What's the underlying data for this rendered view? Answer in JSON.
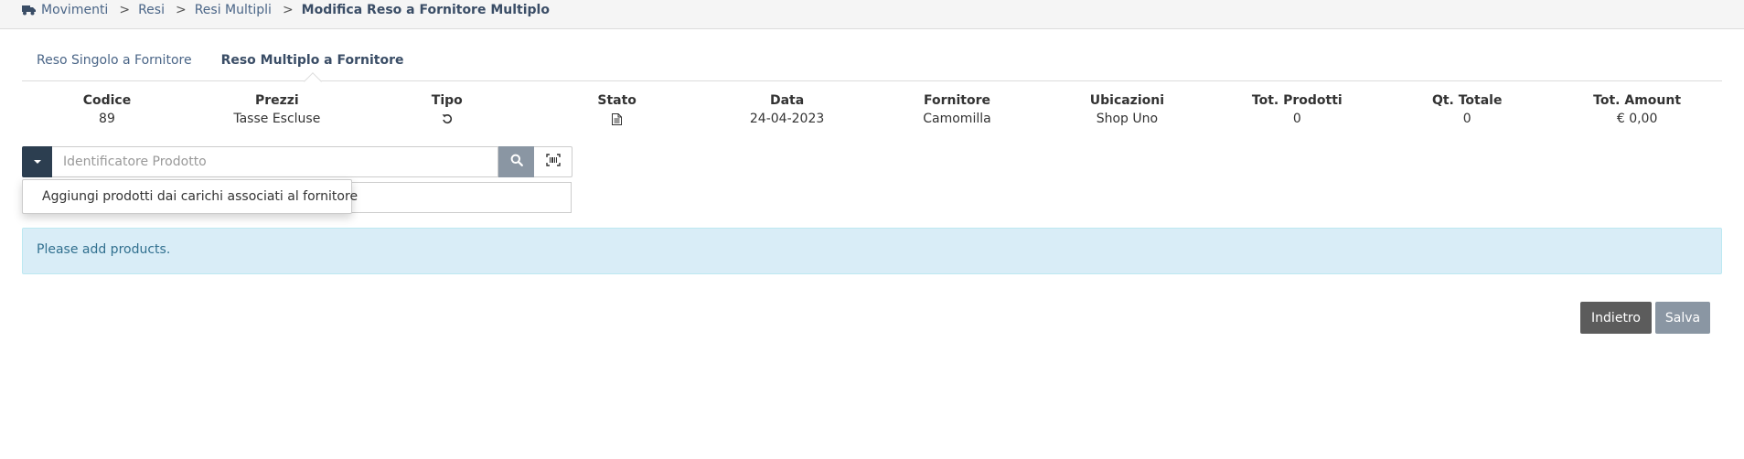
{
  "breadcrumb": {
    "icon": "truck-icon",
    "items": [
      "Movimenti",
      "Resi",
      "Resi Multipli"
    ],
    "separator": ">",
    "current": "Modifica Reso a Fornitore Multiplo"
  },
  "tabs": [
    {
      "label": "Reso Singolo a Fornitore",
      "active": false
    },
    {
      "label": "Reso Multiplo a Fornitore",
      "active": true
    }
  ],
  "summary": {
    "codice": {
      "label": "Codice",
      "value": "89"
    },
    "prezzi": {
      "label": "Prezzi",
      "value": "Tasse Escluse"
    },
    "tipo": {
      "label": "Tipo",
      "icon": "undo-icon"
    },
    "stato": {
      "label": "Stato",
      "icon": "document-icon"
    },
    "data": {
      "label": "Data",
      "value": "24-04-2023"
    },
    "fornitore": {
      "label": "Fornitore",
      "value": "Camomilla"
    },
    "ubicazioni": {
      "label": "Ubicazioni",
      "value": "Shop Uno"
    },
    "tot_prodotti": {
      "label": "Tot. Prodotti",
      "value": "0"
    },
    "qt_totale": {
      "label": "Qt. Totale",
      "value": "0"
    },
    "tot_amount": {
      "label": "Tot. Amount",
      "value": "€ 0,00"
    }
  },
  "search": {
    "placeholder": "Identificatore Prodotto",
    "value": ""
  },
  "dropdown": {
    "item": "Aggiungi prodotti dai carichi associati al fornitore"
  },
  "alert": {
    "message": "Please add products."
  },
  "buttons": {
    "back": "Indietro",
    "save": "Salva"
  },
  "colors": {
    "primary_dark": "#2c3e50",
    "muted": "#8a96a3",
    "alert_bg": "#d9edf7",
    "alert_text": "#31708f"
  }
}
